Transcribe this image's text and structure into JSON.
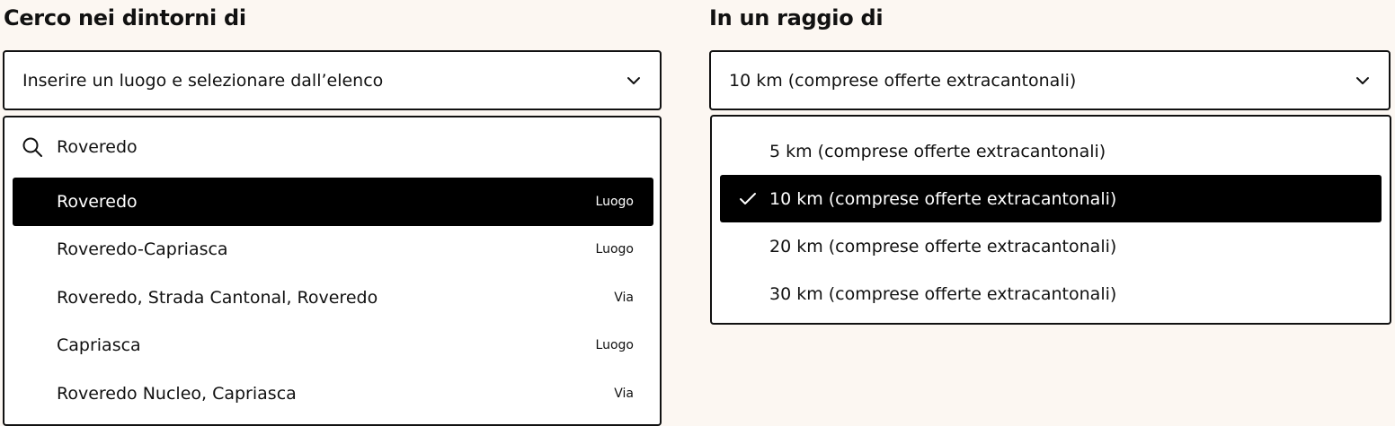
{
  "location_panel": {
    "title": "Cerco nei dintorni di",
    "select_placeholder": "Inserire un luogo e selezionare dall’elenco",
    "search_icon": "search-icon",
    "chevron_icon": "chevron-down-icon",
    "search_value": "Roveredo",
    "suggestions": [
      {
        "label": "Roveredo",
        "type": "Luogo",
        "selected": true
      },
      {
        "label": "Roveredo-Capriasca",
        "type": "Luogo",
        "selected": false
      },
      {
        "label": "Roveredo, Strada Cantonal, Roveredo",
        "type": "Via",
        "selected": false
      },
      {
        "label": "Capriasca",
        "type": "Luogo",
        "selected": false
      },
      {
        "label": "Roveredo Nucleo, Capriasca",
        "type": "Via",
        "selected": false
      }
    ]
  },
  "radius_panel": {
    "title": "In un raggio di",
    "selected_value": "10 km (comprese offerte extracantonali)",
    "chevron_icon": "chevron-down-icon",
    "check_icon": "checkmark-icon",
    "options": [
      {
        "label": "5 km (comprese offerte extracantonali)",
        "selected": false
      },
      {
        "label": "10 km (comprese offerte extracantonali)",
        "selected": true
      },
      {
        "label": "20 km (comprese offerte extracantonali)",
        "selected": false
      },
      {
        "label": "30 km (comprese offerte extracantonali)",
        "selected": false
      }
    ]
  },
  "colors": {
    "background": "#fcf7f2",
    "selected_bg": "#000000",
    "selected_text": "#ffffff",
    "border": "#111111"
  }
}
